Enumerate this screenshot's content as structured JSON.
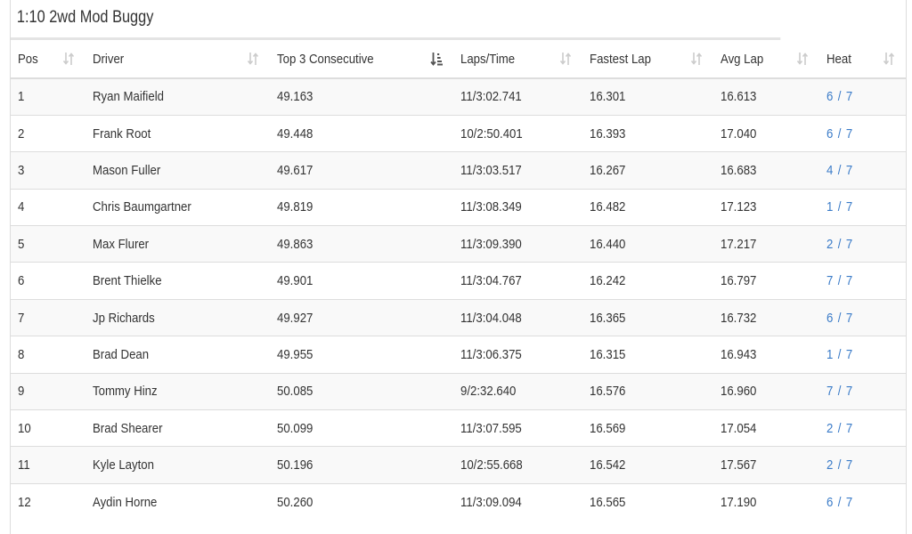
{
  "panel": {
    "title": "1:10 2wd Mod Buggy"
  },
  "columns": [
    {
      "key": "pos",
      "label": "Pos",
      "sort": "none"
    },
    {
      "key": "driver",
      "label": "Driver",
      "sort": "none"
    },
    {
      "key": "top3",
      "label": "Top 3 Consecutive",
      "sort": "ascending"
    },
    {
      "key": "laps",
      "label": "Laps/Time",
      "sort": "none"
    },
    {
      "key": "fastest",
      "label": "Fastest Lap",
      "sort": "none"
    },
    {
      "key": "avg",
      "label": "Avg Lap",
      "sort": "none"
    },
    {
      "key": "heat",
      "label": "Heat",
      "sort": "none"
    }
  ],
  "rows": [
    {
      "pos": "1",
      "driver": "Ryan Maifield",
      "top3": "49.163",
      "laps": "11/3:02.741",
      "fastest": "16.301",
      "avg": "16.613",
      "heat": "6 / 7"
    },
    {
      "pos": "2",
      "driver": "Frank Root",
      "top3": "49.448",
      "laps": "10/2:50.401",
      "fastest": "16.393",
      "avg": "17.040",
      "heat": "6 / 7"
    },
    {
      "pos": "3",
      "driver": "Mason Fuller",
      "top3": "49.617",
      "laps": "11/3:03.517",
      "fastest": "16.267",
      "avg": "16.683",
      "heat": "4 / 7"
    },
    {
      "pos": "4",
      "driver": "Chris Baumgartner",
      "top3": "49.819",
      "laps": "11/3:08.349",
      "fastest": "16.482",
      "avg": "17.123",
      "heat": "1 / 7"
    },
    {
      "pos": "5",
      "driver": "Max Flurer",
      "top3": "49.863",
      "laps": "11/3:09.390",
      "fastest": "16.440",
      "avg": "17.217",
      "heat": "2 / 7"
    },
    {
      "pos": "6",
      "driver": "Brent Thielke",
      "top3": "49.901",
      "laps": "11/3:04.767",
      "fastest": "16.242",
      "avg": "16.797",
      "heat": "7 / 7"
    },
    {
      "pos": "7",
      "driver": "Jp Richards",
      "top3": "49.927",
      "laps": "11/3:04.048",
      "fastest": "16.365",
      "avg": "16.732",
      "heat": "6 / 7"
    },
    {
      "pos": "8",
      "driver": "Brad Dean",
      "top3": "49.955",
      "laps": "11/3:06.375",
      "fastest": "16.315",
      "avg": "16.943",
      "heat": "1 / 7"
    },
    {
      "pos": "9",
      "driver": "Tommy Hinz",
      "top3": "50.085",
      "laps": "9/2:32.640",
      "fastest": "16.576",
      "avg": "16.960",
      "heat": "7 / 7"
    },
    {
      "pos": "10",
      "driver": "Brad Shearer",
      "top3": "50.099",
      "laps": "11/3:07.595",
      "fastest": "16.569",
      "avg": "17.054",
      "heat": "2 / 7"
    },
    {
      "pos": "11",
      "driver": "Kyle Layton",
      "top3": "50.196",
      "laps": "10/2:55.668",
      "fastest": "16.542",
      "avg": "17.567",
      "heat": "2 / 7"
    },
    {
      "pos": "12",
      "driver": "Aydin Horne",
      "top3": "50.260",
      "laps": "11/3:09.094",
      "fastest": "16.565",
      "avg": "17.190",
      "heat": "6 / 7"
    }
  ],
  "colors": {
    "link": "#3a7bc8",
    "sort_icon_idle": "#cccccc",
    "sort_icon_active": "#555555",
    "stripe": "#f9f9f9",
    "border": "#dddddd"
  }
}
